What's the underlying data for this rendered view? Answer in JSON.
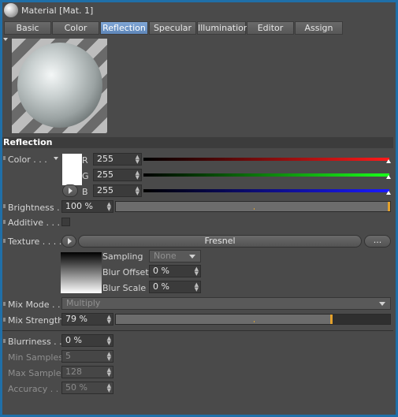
{
  "window": {
    "title": "Material [Mat. 1]"
  },
  "tabs": [
    {
      "label": "Basic"
    },
    {
      "label": "Color"
    },
    {
      "label": "Reflection"
    },
    {
      "label": "Specular"
    },
    {
      "label": "Illumination"
    },
    {
      "label": "Editor"
    },
    {
      "label": "Assign"
    }
  ],
  "active_tab": "Reflection",
  "section": {
    "title": "Reflection"
  },
  "color": {
    "label": "Color . . .",
    "r_label": "R",
    "g_label": "G",
    "b_label": "B",
    "r_value": "255",
    "g_value": "255",
    "b_value": "255",
    "swatch_color": "#ffffff"
  },
  "brightness": {
    "label": "Brightness . . .",
    "value": "100 %",
    "fraction": 1.0
  },
  "additive": {
    "label": "Additive . . .",
    "checked": false
  },
  "texture": {
    "label": "Texture . . . .",
    "name": "Fresnel",
    "more_button": "...",
    "sampling_label": "Sampling",
    "sampling_value": "None",
    "blur_offset_label": "Blur Offset",
    "blur_offset_value": "0 %",
    "blur_scale_label": "Blur Scale",
    "blur_scale_value": "0 %"
  },
  "mix_mode": {
    "label": "Mix Mode . . .",
    "value": "Multiply"
  },
  "mix_strength": {
    "label": "Mix Strength",
    "value": "79 %",
    "fraction": 0.79
  },
  "blurriness": {
    "label": "Blurriness . . .",
    "value": "0 %"
  },
  "min_samples": {
    "label": "Min Samples",
    "value": "5"
  },
  "max_samples": {
    "label": "Max Samples",
    "value": "128"
  },
  "accuracy": {
    "label": "Accuracy . . .",
    "value": "50 %"
  },
  "colors": {
    "accent": "#e3a12c",
    "active_tab": "#7fa6d6",
    "window_border": "#1f6fa8"
  }
}
